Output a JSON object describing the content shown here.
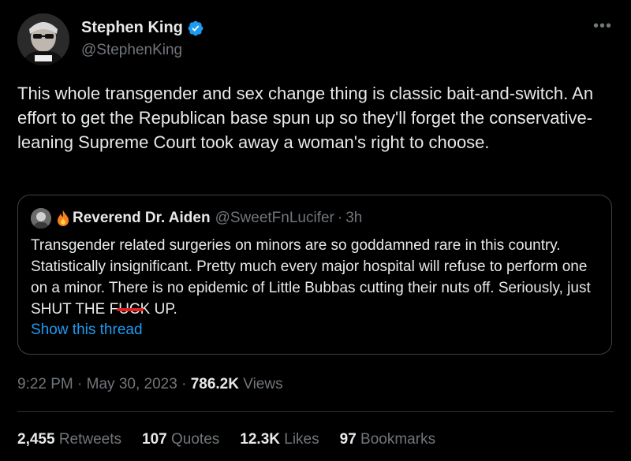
{
  "author": {
    "name": "Stephen King",
    "handle": "@StephenKing",
    "verified_color": "#1d9bf0"
  },
  "tweet": {
    "text": "This whole transgender and sex change thing is classic bait-and-switch. An effort to get the Republican base spun up so they'll forget the conservative-leaning Supreme Court took away a woman's right to choose."
  },
  "quote": {
    "name": "Reverend Dr. Aiden",
    "handle": "@SweetFnLucifer",
    "separator": "·",
    "time": "3h",
    "text_before": "Transgender related surgeries on minors are so goddamned rare in this country. Statistically insignificant. Pretty much every major hospital will refuse to perform one on a minor. There is no epidemic of Little Bubbas cutting their nuts off. Seriously, just SHUT THE F",
    "text_redacted": "UC",
    "text_after": "K UP.",
    "show_thread": "Show this thread"
  },
  "meta": {
    "time": "9:22 PM",
    "separator": "·",
    "date": "May 30, 2023",
    "views_count": "786.2K",
    "views_label": "Views"
  },
  "stats": {
    "retweets_count": "2,455",
    "retweets_label": "Retweets",
    "quotes_count": "107",
    "quotes_label": "Quotes",
    "likes_count": "12.3K",
    "likes_label": "Likes",
    "bookmarks_count": "97",
    "bookmarks_label": "Bookmarks"
  },
  "colors": {
    "background": "#000000",
    "text": "#e7e9ea",
    "secondary": "#71767b",
    "link": "#1d9bf0",
    "redaction": "#e0201c"
  }
}
